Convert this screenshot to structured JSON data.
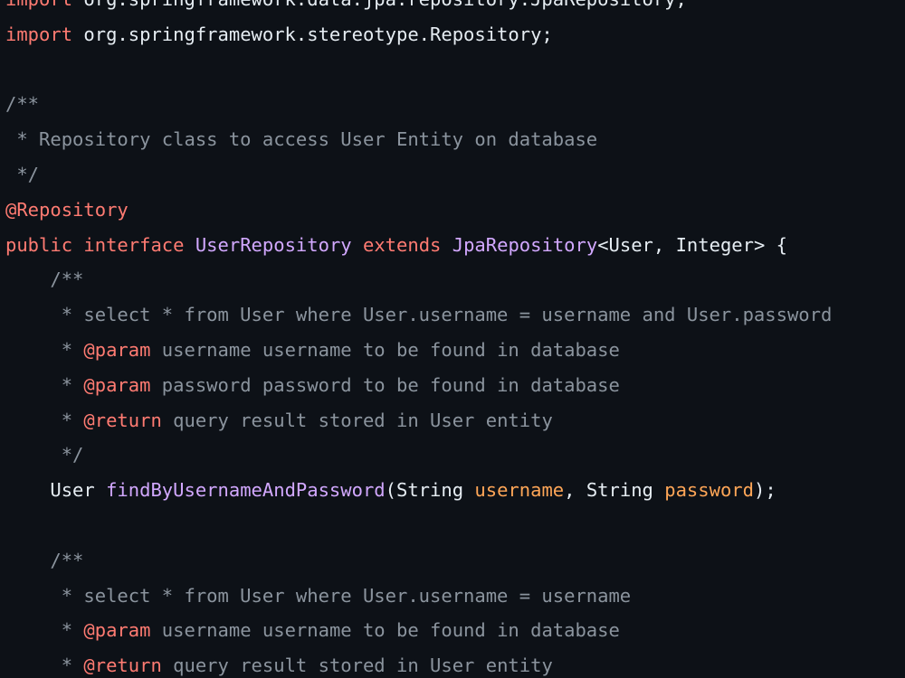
{
  "theme": {
    "background": "#0d1117",
    "text": "#e6edf3",
    "keyword": "#ff7b72",
    "comment": "#8b949e",
    "type": "#d2a8ff",
    "parameter": "#ffa657"
  },
  "code": {
    "lines": [
      [
        {
          "t": "keyword",
          "v": "import"
        },
        {
          "t": "plain",
          "v": " org.springframework.data.jpa.repository.JpaRepository;"
        }
      ],
      [
        {
          "t": "keyword",
          "v": "import"
        },
        {
          "t": "plain",
          "v": " org.springframework.stereotype.Repository;"
        }
      ],
      [],
      [
        {
          "t": "comment",
          "v": "/**"
        }
      ],
      [
        {
          "t": "comment",
          "v": " * Repository class to access User Entity on database"
        }
      ],
      [
        {
          "t": "comment",
          "v": " */"
        }
      ],
      [
        {
          "t": "annotation",
          "v": "@Repository"
        }
      ],
      [
        {
          "t": "keyword",
          "v": "public"
        },
        {
          "t": "plain",
          "v": " "
        },
        {
          "t": "keyword",
          "v": "interface"
        },
        {
          "t": "plain",
          "v": " "
        },
        {
          "t": "type",
          "v": "UserRepository"
        },
        {
          "t": "plain",
          "v": " "
        },
        {
          "t": "keyword",
          "v": "extends"
        },
        {
          "t": "plain",
          "v": " "
        },
        {
          "t": "type",
          "v": "JpaRepository"
        },
        {
          "t": "plain",
          "v": "<User, Integer> {"
        }
      ],
      [
        {
          "t": "comment",
          "v": "    /**"
        }
      ],
      [
        {
          "t": "comment",
          "v": "     * select * from User where User.username = username and User.password"
        }
      ],
      [
        {
          "t": "comment",
          "v": "     * "
        },
        {
          "t": "doctag",
          "v": "@param"
        },
        {
          "t": "comment",
          "v": " username username to be found in database"
        }
      ],
      [
        {
          "t": "comment",
          "v": "     * "
        },
        {
          "t": "doctag",
          "v": "@param"
        },
        {
          "t": "comment",
          "v": " password password to be found in database"
        }
      ],
      [
        {
          "t": "comment",
          "v": "     * "
        },
        {
          "t": "doctag",
          "v": "@return"
        },
        {
          "t": "comment",
          "v": " query result stored in User entity"
        }
      ],
      [
        {
          "t": "comment",
          "v": "     */"
        }
      ],
      [
        {
          "t": "plain",
          "v": "    User "
        },
        {
          "t": "func",
          "v": "findByUsernameAndPassword"
        },
        {
          "t": "plain",
          "v": "(String "
        },
        {
          "t": "param",
          "v": "username"
        },
        {
          "t": "plain",
          "v": ", String "
        },
        {
          "t": "param",
          "v": "password"
        },
        {
          "t": "plain",
          "v": ");"
        }
      ],
      [],
      [
        {
          "t": "comment",
          "v": "    /**"
        }
      ],
      [
        {
          "t": "comment",
          "v": "     * select * from User where User.username = username"
        }
      ],
      [
        {
          "t": "comment",
          "v": "     * "
        },
        {
          "t": "doctag",
          "v": "@param"
        },
        {
          "t": "comment",
          "v": " username username to be found in database"
        }
      ],
      [
        {
          "t": "comment",
          "v": "     * "
        },
        {
          "t": "doctag",
          "v": "@return"
        },
        {
          "t": "comment",
          "v": " query result stored in User entity"
        }
      ]
    ]
  }
}
